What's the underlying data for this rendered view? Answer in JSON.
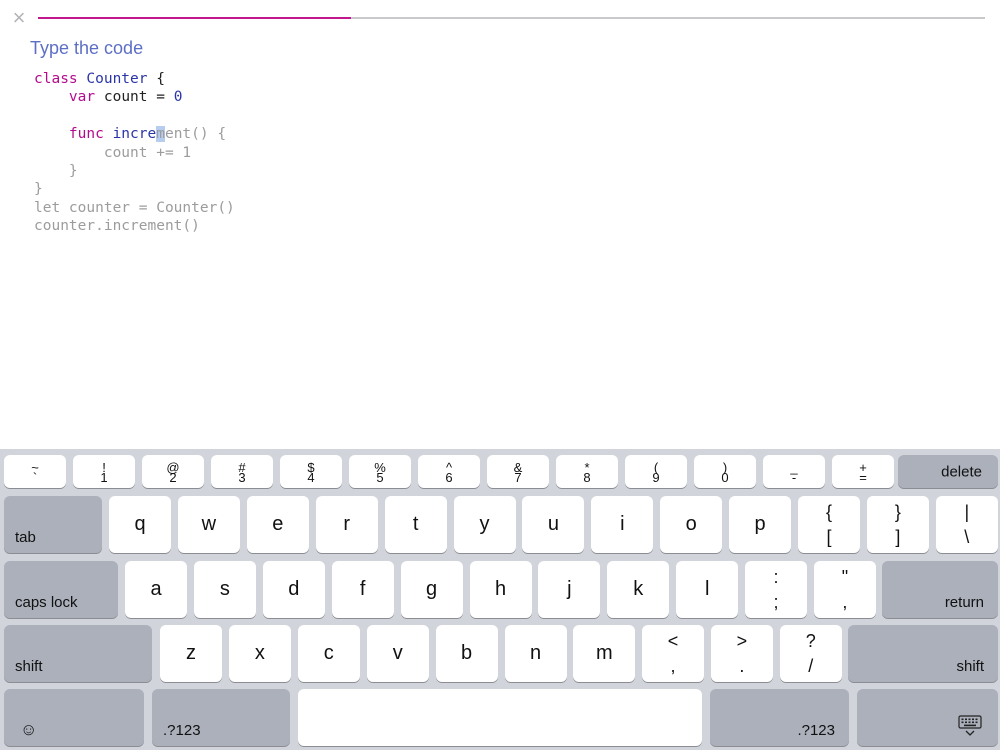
{
  "header": {
    "close_icon": "×",
    "progress_percent": 33,
    "progress_color": "#c2188f",
    "title": "Type the code"
  },
  "code_lines": [
    [
      {
        "t": "class",
        "s": "kw"
      },
      {
        "t": " ",
        "s": "done"
      },
      {
        "t": "Counter",
        "s": "ty"
      },
      {
        "t": " {",
        "s": "done"
      }
    ],
    [
      {
        "t": "    ",
        "s": "done"
      },
      {
        "t": "var",
        "s": "kw"
      },
      {
        "t": " count = ",
        "s": "done"
      },
      {
        "t": "0",
        "s": "num"
      }
    ],
    [],
    [
      {
        "t": "    ",
        "s": "done"
      },
      {
        "t": "func",
        "s": "kw"
      },
      {
        "t": " ",
        "s": "done"
      },
      {
        "t": "incre",
        "s": "ty"
      },
      {
        "t": "m",
        "s": "cursor"
      },
      {
        "t": "ent() {",
        "s": "rest"
      }
    ],
    [
      {
        "t": "        count += 1",
        "s": "rest"
      }
    ],
    [
      {
        "t": "    }",
        "s": "rest"
      }
    ],
    [
      {
        "t": "}",
        "s": "rest"
      }
    ],
    [
      {
        "t": "let counter = Counter()",
        "s": "rest"
      }
    ],
    [
      {
        "t": "counter.increment()",
        "s": "rest"
      }
    ]
  ],
  "keyboard": {
    "row1": [
      {
        "top": "~",
        "bottom": "`"
      },
      {
        "top": "!",
        "bottom": "1"
      },
      {
        "top": "@",
        "bottom": "2"
      },
      {
        "top": "#",
        "bottom": "3"
      },
      {
        "top": "$",
        "bottom": "4"
      },
      {
        "top": "%",
        "bottom": "5"
      },
      {
        "top": "^",
        "bottom": "6"
      },
      {
        "top": "&",
        "bottom": "7"
      },
      {
        "top": "*",
        "bottom": "8"
      },
      {
        "top": "(",
        "bottom": "9"
      },
      {
        "top": ")",
        "bottom": "0"
      },
      {
        "top": "_",
        "bottom": "-"
      },
      {
        "top": "+",
        "bottom": "="
      }
    ],
    "delete_label": "delete",
    "tab_label": "tab",
    "row2": [
      "q",
      "w",
      "e",
      "r",
      "t",
      "y",
      "u",
      "i",
      "o",
      "p"
    ],
    "row2_sym": [
      {
        "top": "{",
        "bottom": "["
      },
      {
        "top": "}",
        "bottom": "]"
      },
      {
        "top": "|",
        "bottom": "\\"
      }
    ],
    "caps_label": "caps lock",
    "row3": [
      "a",
      "s",
      "d",
      "f",
      "g",
      "h",
      "j",
      "k",
      "l"
    ],
    "row3_sym": [
      {
        "top": ":",
        "bottom": ";"
      },
      {
        "top": "\"",
        "bottom": ","
      }
    ],
    "return_label": "return",
    "shift_label": "shift",
    "row4": [
      "z",
      "x",
      "c",
      "v",
      "b",
      "n",
      "m"
    ],
    "row4_sym": [
      {
        "top": "<",
        "bottom": ","
      },
      {
        "top": ">",
        "bottom": "."
      },
      {
        "top": "?",
        "bottom": "/"
      }
    ],
    "emoji_icon": "☺",
    "numbers_label": ".?123",
    "hide_keyboard_icon": "keyboard-hide"
  }
}
